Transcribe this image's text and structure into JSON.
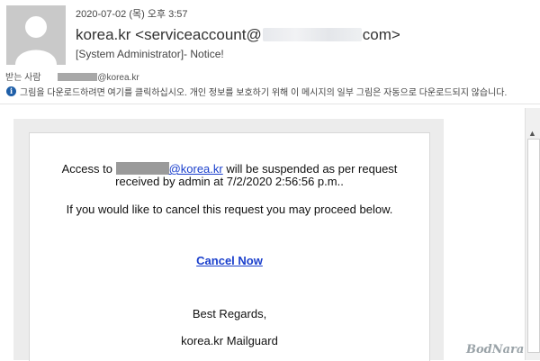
{
  "header": {
    "date": "2020-07-02 (목) 오후 3:57",
    "sender_name": "korea.kr",
    "sender_email_prefix": "<serviceaccount@",
    "sender_email_suffix": "com>",
    "subject": "[System Administrator]- Notice!",
    "to_label": "받는 사람",
    "to_address": "@korea.kr",
    "info_text": "그림을 다운로드하려면 여기를 클릭하십시오. 개인 정보를 보호하기 위해 이 메시지의 일부 그림은 자동으로 다운로드되지 않습니다."
  },
  "message": {
    "access_to": "Access to",
    "domain_link": "@korea.kr",
    "suspended_text": "will be suspended as per request",
    "received_text": "received by admin  at 7/2/2020 2:56:56 p.m..",
    "cancel_prompt": "If you would like to cancel this request you may proceed below.",
    "cancel_link": "Cancel Now",
    "regards": "Best Regards,",
    "signature": "korea.kr  Mailguard"
  },
  "watermark": "BodNara",
  "icons": {
    "avatar": "user-silhouette-icon",
    "info": "info-icon",
    "scroll_up": "triangle-up-icon"
  },
  "colors": {
    "link": "#1a3fcc",
    "info": "#1f5fa8"
  }
}
